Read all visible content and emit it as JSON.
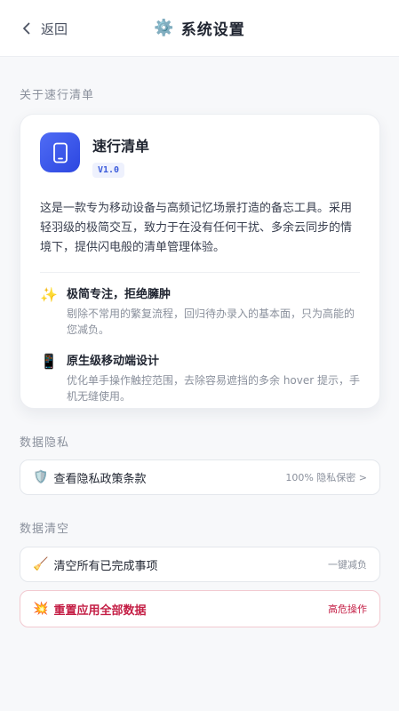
{
  "header": {
    "back_label": "返回",
    "title_icon": "⚙️",
    "title": "系统设置"
  },
  "about": {
    "section_label": "关于速行清单",
    "app_name": "速行清单",
    "version": "V1.0",
    "description": "这是一款专为移动设备与高频记忆场景打造的备忘工具。采用轻羽级的极简交互，致力于在没有任何干扰、多余云同步的情境下，提供闪电般的清单管理体验。",
    "features": [
      {
        "icon": "✨",
        "title": "极简专注，拒绝臃肿",
        "desc": "剔除不常用的繁复流程，回归待办录入的基本面，只为高能的您减负。"
      },
      {
        "icon": "📱",
        "title": "原生级移动端设计",
        "desc": "优化单手操作触控范围，去除容易遮挡的多余 hover 提示，手机无缝使用。"
      }
    ]
  },
  "privacy": {
    "section_label": "数据隐私",
    "icon": "🛡️",
    "label": "查看隐私政策条款",
    "meta": "100% 隐私保密 >"
  },
  "clear": {
    "section_label": "数据清空",
    "clear_done": {
      "icon": "🧹",
      "label": "清空所有已完成事项",
      "meta": "一键减负"
    },
    "reset_all": {
      "icon": "💥",
      "label": "重置应用全部数据",
      "meta": "高危操作"
    }
  },
  "colors": {
    "accent": "#3b5bdb",
    "danger": "#c41e45",
    "background": "#f7f8fa"
  }
}
